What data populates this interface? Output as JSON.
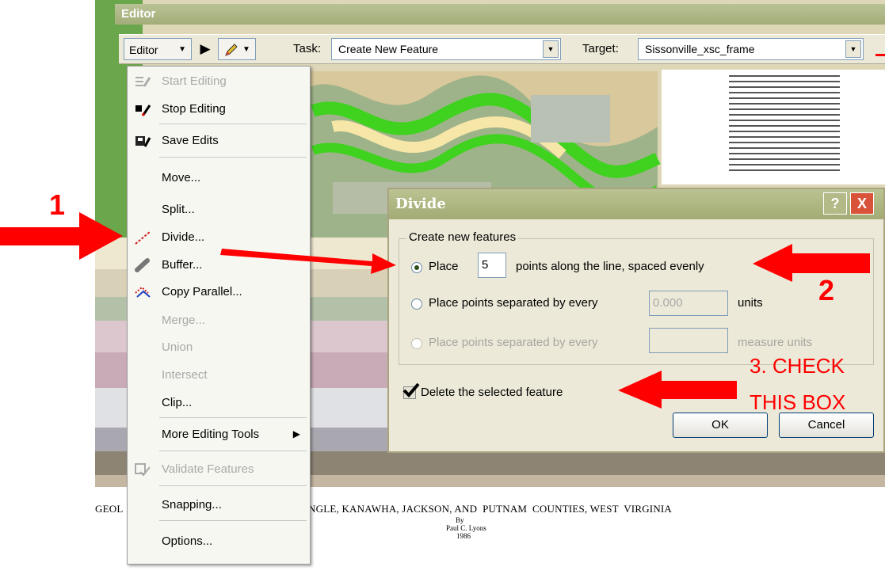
{
  "editor": {
    "title": "Editor",
    "menu_button_label": "Editor",
    "task_label": "Task:",
    "task_value": "Create New Feature",
    "target_label": "Target:",
    "target_value": "Sissonville_xsc_frame"
  },
  "menu": {
    "items": [
      {
        "label": "Start Editing",
        "enabled": false
      },
      {
        "label": "Stop Editing",
        "enabled": true
      },
      {
        "label": "Save Edits",
        "enabled": true
      },
      {
        "label": "Move...",
        "enabled": true
      },
      {
        "label": "Split...",
        "enabled": true
      },
      {
        "label": "Divide...",
        "enabled": true
      },
      {
        "label": "Buffer...",
        "enabled": true
      },
      {
        "label": "Copy Parallel...",
        "enabled": true
      },
      {
        "label": "Merge...",
        "enabled": false
      },
      {
        "label": "Union",
        "enabled": false
      },
      {
        "label": "Intersect",
        "enabled": false
      },
      {
        "label": "Clip...",
        "enabled": true
      },
      {
        "label": "More Editing Tools",
        "enabled": true
      },
      {
        "label": "Validate Features",
        "enabled": false
      },
      {
        "label": "Snapping...",
        "enabled": true
      },
      {
        "label": "Options...",
        "enabled": true
      }
    ]
  },
  "dialog": {
    "title": "Divide",
    "help": "?",
    "close": "X",
    "group_label": "Create new features",
    "option1_pre": "Place",
    "option1_value": "5",
    "option1_post": "points along the line, spaced evenly",
    "option2_label": "Place points separated by every",
    "option2_value": "0.000",
    "option2_units": "units",
    "option3_label": "Place points separated by every",
    "option3_value": "",
    "option3_units": "measure units",
    "checkbox_label": "Delete the selected feature",
    "ok": "OK",
    "cancel": "Cancel"
  },
  "annotations": {
    "step1": "1",
    "step2": "2",
    "step3_line1": "3. CHECK",
    "step3_line2": "THIS BOX"
  },
  "map": {
    "caption": "GEOL                                         ILLE  QUADRANGLE, KANAWHA, JACKSON, AND  PUTNAM  COUNTIES, WEST  VIRGINIA",
    "by": "By",
    "author": "Paul C. Lyons",
    "year": "1986"
  },
  "colors": {
    "annotation": "#ff0000",
    "titlebar": "#a9b27d",
    "dialog_bg": "#ece9d8"
  }
}
